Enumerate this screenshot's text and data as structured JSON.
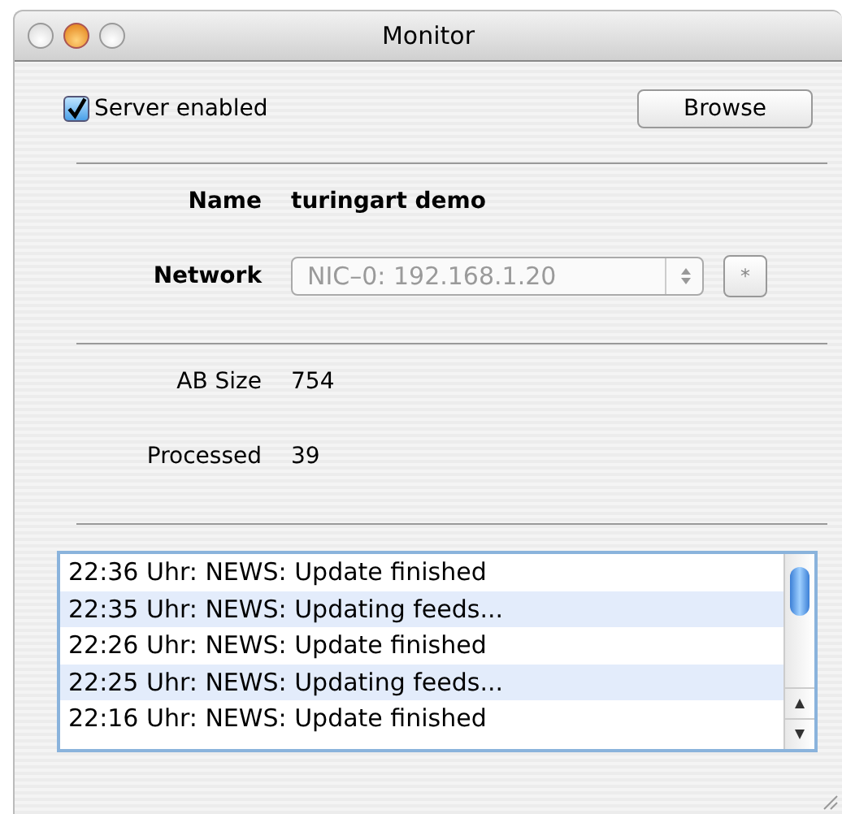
{
  "window": {
    "title": "Monitor"
  },
  "server_enabled": {
    "label": "Server enabled",
    "checked": true
  },
  "browse_button": {
    "label": "Browse"
  },
  "name": {
    "label": "Name",
    "value": "turingart demo"
  },
  "network": {
    "label": "Network",
    "value": "NIC–0: 192.168.1.20",
    "disabled": true,
    "extra_button": "*"
  },
  "stats": [
    {
      "label": "AB Size",
      "value": "754"
    },
    {
      "label": "Processed",
      "value": "39"
    }
  ],
  "log": [
    {
      "text": "22:36 Uhr: NEWS: Update finished"
    },
    {
      "text": "22:35 Uhr: NEWS: Updating feeds..."
    },
    {
      "text": "22:26 Uhr: NEWS: Update finished"
    },
    {
      "text": "22:25 Uhr: NEWS: Updating feeds..."
    },
    {
      "text": "22:16 Uhr: NEWS: Update finished"
    }
  ]
}
